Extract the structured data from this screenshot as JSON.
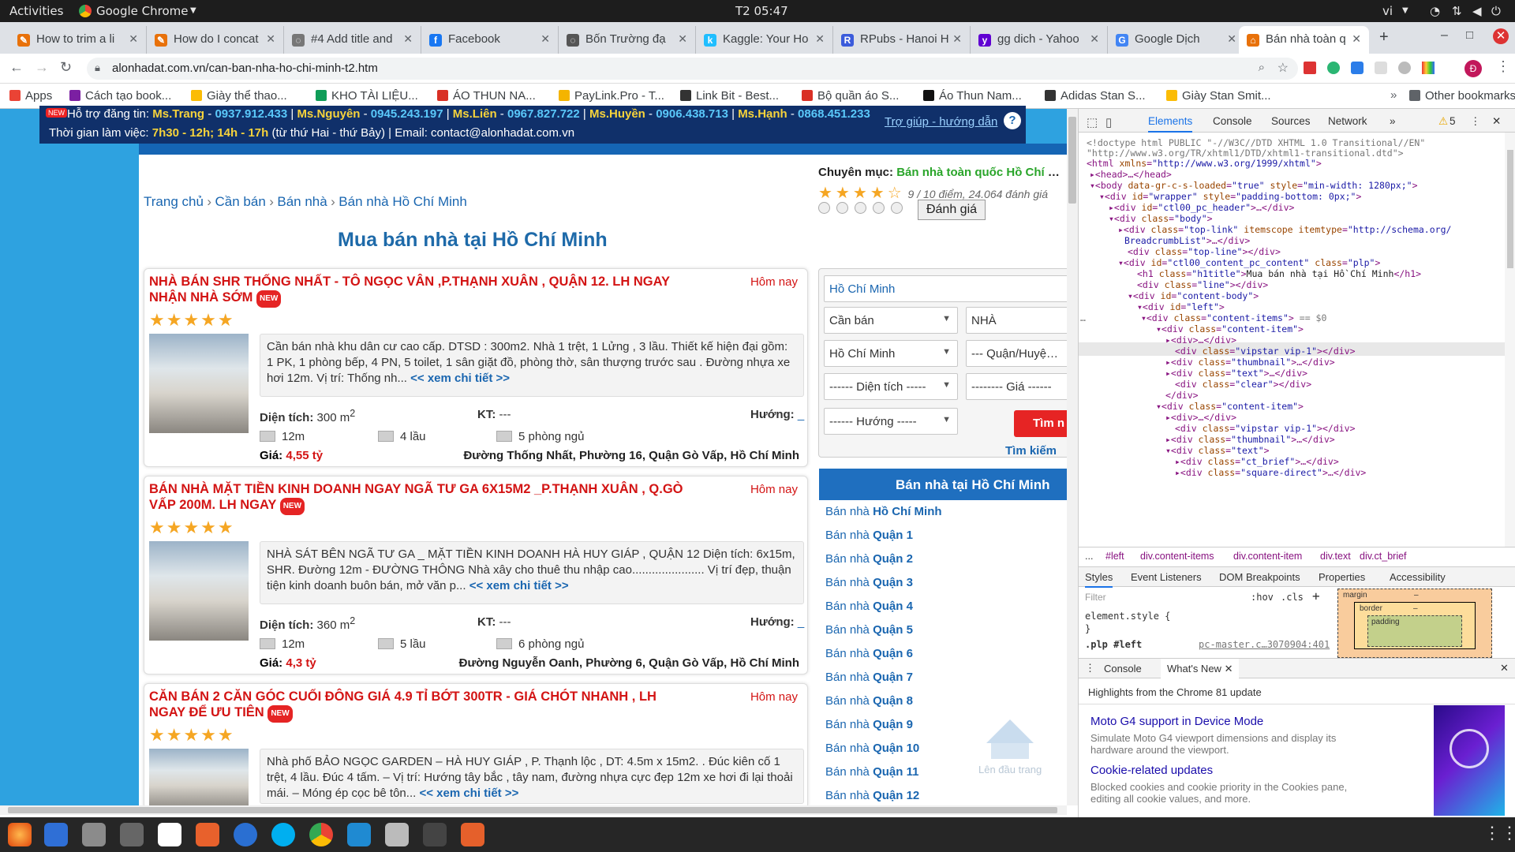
{
  "system_bar": {
    "activities": "Activities",
    "app_name": "Google Chrome",
    "clock": "T2 05:47",
    "lang": "vi"
  },
  "tabs": [
    {
      "label": "How to trim a li",
      "fav_color": "#e8710a",
      "fav": "✎"
    },
    {
      "label": "How do I concat",
      "fav_color": "#e8710a",
      "fav": "✎"
    },
    {
      "label": "#4 Add title and",
      "fav_color": "#777777",
      "fav": "◌"
    },
    {
      "label": "Facebook",
      "fav_color": "#1877f2",
      "fav": "f"
    },
    {
      "label": "Bốn Trường đạ",
      "fav_color": "#555555",
      "fav": "◌"
    },
    {
      "label": "Kaggle: Your Ho",
      "fav_color": "#20beff",
      "fav": "k"
    },
    {
      "label": "RPubs - Hanoi H",
      "fav_color": "#3b5bdb",
      "fav": "R"
    },
    {
      "label": "gg dich - Yahoo",
      "fav_color": "#6001d2",
      "fav": "y"
    },
    {
      "label": "Google Dịch",
      "fav_color": "#4285f4",
      "fav": "G"
    },
    {
      "label": "Bán nhà toàn q",
      "fav_color": "#e8710a",
      "fav": "⌂",
      "active": true
    }
  ],
  "address": {
    "url": "alonhadat.com.vn/can-ban-nha-ho-chi-minh-t2.htm"
  },
  "bookmarks": [
    {
      "label": "Apps",
      "color": "#ea4335"
    },
    {
      "label": "Cách tạo book...",
      "color": "#7b1fa2"
    },
    {
      "label": "Giày thể thao...",
      "color": "#fbbc05"
    },
    {
      "label": "KHO TÀI LIỆU...",
      "color": "#0f9d58"
    },
    {
      "label": "ÁO THUN NA...",
      "color": "#d93025"
    },
    {
      "label": "PayLink.Pro - T...",
      "color": "#f4b400"
    },
    {
      "label": "Link Bit - Best...",
      "color": "#333333"
    },
    {
      "label": "Bộ quần áo S...",
      "color": "#d93025"
    },
    {
      "label": "Áo Thun Nam...",
      "color": "#111111"
    },
    {
      "label": "Adidas Stan S...",
      "color": "#333333"
    },
    {
      "label": "Giày Stan Smit...",
      "color": "#fbbc05"
    },
    {
      "label": "Other bookmarks",
      "color": "#5f6368"
    }
  ],
  "support": {
    "intro": "Hỗ trợ đăng tin:",
    "contacts": [
      {
        "name": "Ms.Trang",
        "phone": "0937.912.433"
      },
      {
        "name": "Ms.Nguyên",
        "phone": "0945.243.197"
      },
      {
        "name": "Ms.Liên",
        "phone": "0967.827.722"
      },
      {
        "name": "Ms.Huyền",
        "phone": "0906.438.713"
      },
      {
        "name": "Ms.Hạnh",
        "phone": "0868.451.233"
      }
    ],
    "hours_label": "Thời gian làm việc:",
    "hours": "7h30 - 12h; 14h - 17h",
    "days": "(từ thứ Hai - thứ Bảy) | Email: contact@alonhadat.com.vn",
    "help": "Trợ giúp - hướng dẫn"
  },
  "breadcrumb": [
    "Trang chủ",
    "Cần bán",
    "Bán nhà",
    "Bán nhà Hồ Chí Minh"
  ],
  "category_info": {
    "label": "Chuyên mục:",
    "value": "Bán nhà toàn quốc Hồ Chí Minh",
    "score": "9 / 10 điểm, 24.064 đánh giá",
    "rate_button": "Đánh giá"
  },
  "page_title": "Mua bán nhà tại Hồ Chí Minh",
  "listings": [
    {
      "title": "NHÀ BÁN SHR THỐNG NHẤT - TÔ NGỌC VÂN ,P.THẠNH XUÂN , QUẬN 12. LH NGAY NHẬN NHÀ SỚM",
      "date": "Hôm nay",
      "brief": "Cần bán nhà khu dân cư cao cấp. DTSD : 300m2. Nhà 1 trệt, 1 Lửng , 3 lầu. Thiết kế hiện đại gồm: 1 PK, 1 phòng bếp, 4 PN, 5 toilet, 1 sân giặt đồ, phòng thờ, sân thượng trước sau . Đường nhựa xe hơi 12m. Vị trí: Thống nh...",
      "area": "300 m",
      "kt": "---",
      "street_width": "12m",
      "floors": "4 lầu",
      "bedrooms": "5 phòng ngủ",
      "price": "4,55 tỷ",
      "address": "Đường Thống Nhất, Phường 16, Quận Gò Vấp, Hồ Chí Minh"
    },
    {
      "title": "BÁN NHÀ MẶT TIỀN KINH DOANH NGAY NGÃ TƯ GA 6X15M2 _P.THẠNH XUÂN , Q.GÒ VẤP 200M. LH NGAY",
      "date": "Hôm nay",
      "brief": "NHÀ SÁT BÊN NGÃ TƯ GA _ MẶT TIỀN KINH DOANH HÀ HUY GIÁP , QUẬN 12 Diện tích: 6x15m, SHR. Đường 12m - ĐƯỜNG THÔNG Nhà xây cho thuê thu nhập cao...................... Vị trí đẹp, thuận tiện kinh doanh buôn bán, mở văn p...",
      "area": "360 m",
      "kt": "---",
      "street_width": "12m",
      "floors": "5 lầu",
      "bedrooms": "6 phòng ngủ",
      "price": "4,3 tỷ",
      "address": "Đường Nguyễn Oanh, Phường 6, Quận Gò Vấp, Hồ Chí Minh"
    },
    {
      "title": "CĂN BÁN 2 CĂN GÓC CUỐI ĐÔNG GIÁ 4.9 TỈ BỚT 300TR - GIÁ CHÓT NHANH , LH NGAY ĐỂ ƯU TIÊN",
      "date": "Hôm nay",
      "brief": "Nhà phố BẢO NGỌC GARDEN – HÀ HUY GIÁP , P. Thạnh lộc , DT: 4.5m x 15m2. . Đúc kiên cố 1 trệt, 4 lầu. Đúc 4 tấm. – Vị trí: Hướng tây bắc , tây nam, đường nhựa cực đẹp 12m xe hơi đi lại thoải mái. – Móng ép cọc bê tôn..."
    }
  ],
  "labels": {
    "area": "Diện tích:",
    "kt": "KT:",
    "direction": "Hướng:",
    "price": "Giá:",
    "more": "<< xem chi tiết >>",
    "new_badge": "NEW",
    "sup2": "2",
    "dash": "_"
  },
  "search": {
    "location": "Hồ Chí Minh",
    "type": "Cần bán",
    "property": "NHÀ",
    "city": "Hồ Chí Minh",
    "district": "--- Quận/Huyện ---",
    "area": "------ Diện tích -----",
    "price": "-------- Giá ------",
    "direction": "------ Hướng -----",
    "button": "Tìm n",
    "advanced": "Tìm kiếm"
  },
  "categories": {
    "header": "Bán nhà tại Hồ Chí Minh",
    "prefix": "Bán nhà",
    "items": [
      "Hồ Chí Minh",
      "Quận 1",
      "Quận 2",
      "Quận 3",
      "Quận 4",
      "Quận 5",
      "Quận 6",
      "Quận 7",
      "Quận 8",
      "Quận 9",
      "Quận 10",
      "Quận 11",
      "Quận 12"
    ]
  },
  "back_to_top": "Lên đầu trang",
  "devtools": {
    "tabs": [
      "Elements",
      "Console",
      "Sources",
      "Network"
    ],
    "warnings": "5",
    "selected_info": "== $0",
    "crumbs": [
      "...",
      "#left",
      "div.content-items",
      "div.content-item",
      "div.text",
      "div.ct_brief"
    ],
    "style_tabs": [
      "Styles",
      "Event Listeners",
      "DOM Breakpoints",
      "Properties",
      "Accessibility"
    ],
    "filter": "Filter",
    "hov": ":hov",
    "cls": ".cls",
    "element_style": "element.style {",
    "brace": "}",
    "rule_selector": ".plp #left",
    "rule_source": "pc-master.c…3070904:401",
    "box_margin": "margin",
    "box_border": "border",
    "box_padding": "padding",
    "box_dash": "–",
    "drawer_tabs": [
      "Console",
      "What's New"
    ],
    "highlights": "Highlights from the Chrome 81 update",
    "news": [
      {
        "title": "Moto G4 support in Device Mode",
        "desc": "Simulate Moto G4 viewport dimensions and display its hardware around the viewport."
      },
      {
        "title": "Cookie-related updates",
        "desc": "Blocked cookies and cookie priority in the Cookies pane, editing all cookie values, and more."
      }
    ]
  }
}
